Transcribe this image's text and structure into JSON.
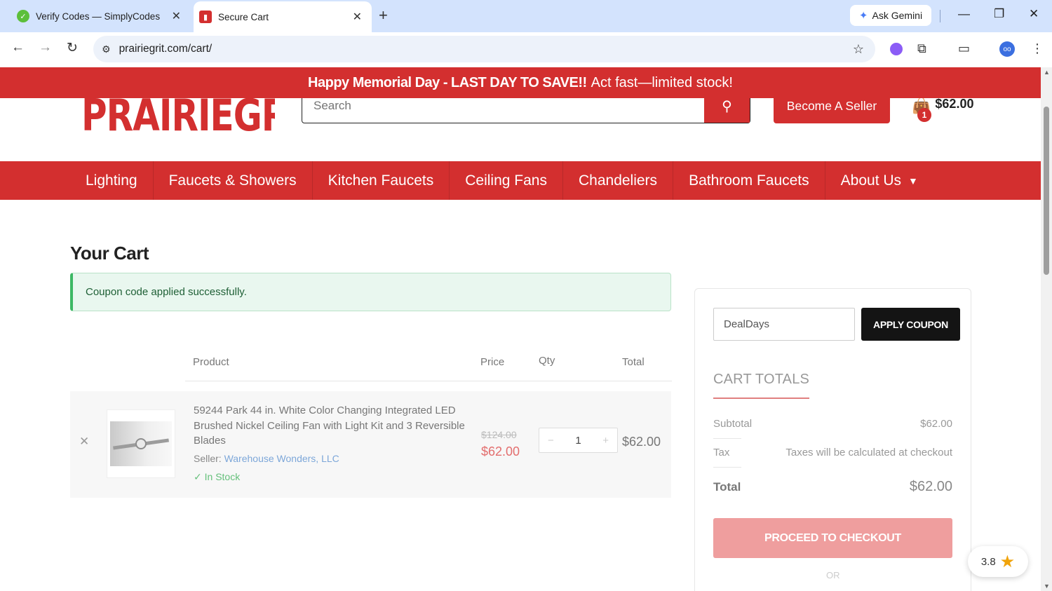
{
  "browser": {
    "tabs": [
      {
        "title": "Verify Codes — SimplyCodes",
        "favicon": "simplycodes-icon"
      },
      {
        "title": "Secure Cart",
        "favicon": "prairiegrit-icon"
      }
    ],
    "gemini_label": "Ask Gemini",
    "url": "prairiegrit.com/cart/"
  },
  "promo": {
    "bold": "Happy Memorial Day - LAST DAY TO SAVE!!",
    "rest": "Act fast—limited stock!"
  },
  "header": {
    "logo_text": "PRAIRIEGRIT",
    "search_placeholder": "Search",
    "seller_button": "Become A Seller",
    "cart_count": "1",
    "cart_total": "$62.00"
  },
  "nav": {
    "items": [
      "Lighting",
      "Faucets & Showers",
      "Kitchen Faucets",
      "Ceiling Fans",
      "Chandeliers",
      "Bathroom Faucets",
      "About Us"
    ]
  },
  "cart": {
    "title": "Your Cart",
    "alert": "Coupon code applied successfully.",
    "columns": {
      "product": "Product",
      "price": "Price",
      "qty": "Qty",
      "total": "Total"
    },
    "items": [
      {
        "name": "59244 Park 44 in. White Color Changing Integrated LED Brushed Nickel Ceiling Fan with Light Kit and 3 Reversible Blades",
        "seller_label": "Seller:",
        "seller": "Warehouse Wonders, LLC",
        "stock": "In Stock",
        "price_old": "$124.00",
        "price_new": "$62.00",
        "qty": "1",
        "total": "$62.00"
      }
    ]
  },
  "sidebar": {
    "coupon_value": "DealDays",
    "apply_label": "APPLY COUPON",
    "totals_title": "CART TOTALS",
    "subtotal_label": "Subtotal",
    "subtotal_value": "$62.00",
    "tax_label": "Tax",
    "tax_value": "Taxes will be calculated at checkout",
    "total_label": "Total",
    "total_value": "$62.00",
    "checkout_label": "PROCEED TO CHECKOUT",
    "or_label": "OR"
  },
  "rating": {
    "value": "3.8"
  },
  "colors": {
    "brand_red": "#d32f2f",
    "success_green": "#3db865",
    "checkout_pink": "#ef9e9e"
  }
}
